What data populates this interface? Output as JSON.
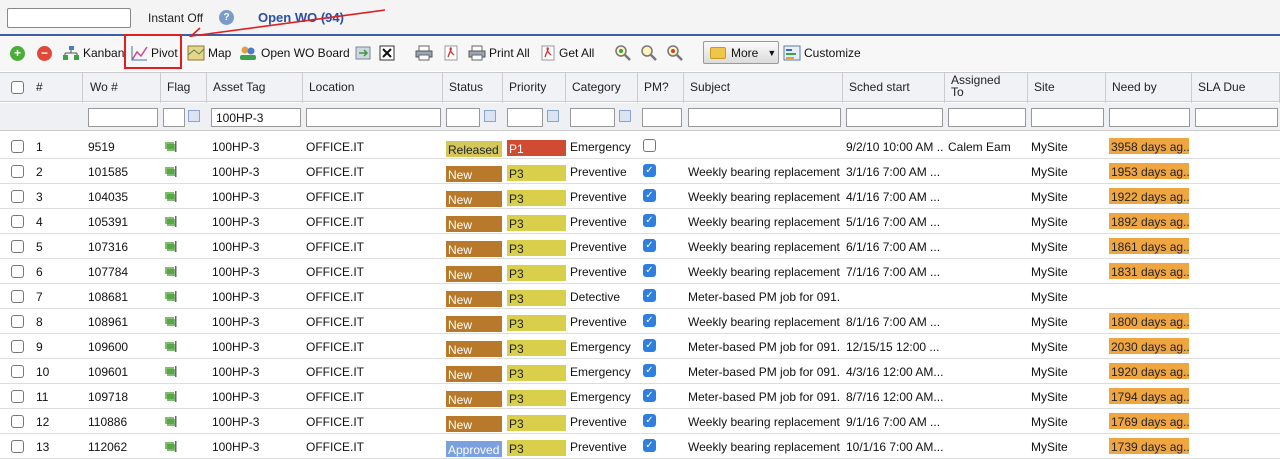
{
  "topbar": {
    "search_value": "",
    "instant_label": "Instant Off",
    "view_title": "Open WO (94)"
  },
  "toolbar": {
    "kanban": "Kanban",
    "pivot": "Pivot",
    "map": "Map",
    "open_wo_board": "Open WO Board",
    "print_all": "Print All",
    "get_all": "Get All",
    "more": "More",
    "customize": "Customize"
  },
  "columns": {
    "num": "#",
    "wo": "Wo #",
    "flag": "Flag",
    "asset_tag": "Asset Tag",
    "location": "Location",
    "status": "Status",
    "priority": "Priority",
    "category": "Category",
    "pm": "PM?",
    "subject": "Subject",
    "sched_start": "Sched start",
    "assigned_to_1": "Assigned",
    "assigned_to_2": "To",
    "site": "Site",
    "need_by": "Need by",
    "sla_due": "SLA Due"
  },
  "filters": {
    "asset_tag": "100HP-3"
  },
  "colors": {
    "status_released": "#d4c85a",
    "status_new": "#b87a2a",
    "status_approved": "#7aa0e0",
    "priority_p1": "#d14a32",
    "priority_p3": "#d9cf4a",
    "need_by": "#f0a640",
    "accent": "#2a4fa8"
  },
  "rows": [
    {
      "n": "1",
      "wo": "9519",
      "asset": "100HP-3",
      "loc": "OFFICE.IT",
      "status": "Released",
      "status_key": "released",
      "priority": "P1",
      "prio_key": "p1",
      "category": "Emergency",
      "pm": false,
      "subject": "",
      "sched": "9/2/10 10:00 AM ...",
      "assigned": "Calem Eam",
      "site": "MySite",
      "need": "3958 days ag..."
    },
    {
      "n": "2",
      "wo": "101585",
      "asset": "100HP-3",
      "loc": "OFFICE.IT",
      "status": "New",
      "status_key": "new",
      "priority": "P3",
      "prio_key": "p3",
      "category": "Preventive",
      "pm": true,
      "subject": "Weekly bearing replacement",
      "sched": "3/1/16 7:00 AM ...",
      "assigned": "",
      "site": "MySite",
      "need": "1953 days ag..."
    },
    {
      "n": "3",
      "wo": "104035",
      "asset": "100HP-3",
      "loc": "OFFICE.IT",
      "status": "New",
      "status_key": "new",
      "priority": "P3",
      "prio_key": "p3",
      "category": "Preventive",
      "pm": true,
      "subject": "Weekly bearing replacement",
      "sched": "4/1/16 7:00 AM ...",
      "assigned": "",
      "site": "MySite",
      "need": "1922 days ag..."
    },
    {
      "n": "4",
      "wo": "105391",
      "asset": "100HP-3",
      "loc": "OFFICE.IT",
      "status": "New",
      "status_key": "new",
      "priority": "P3",
      "prio_key": "p3",
      "category": "Preventive",
      "pm": true,
      "subject": "Weekly bearing replacement",
      "sched": "5/1/16 7:00 AM ...",
      "assigned": "",
      "site": "MySite",
      "need": "1892 days ag..."
    },
    {
      "n": "5",
      "wo": "107316",
      "asset": "100HP-3",
      "loc": "OFFICE.IT",
      "status": "New",
      "status_key": "new",
      "priority": "P3",
      "prio_key": "p3",
      "category": "Preventive",
      "pm": true,
      "subject": "Weekly bearing replacement",
      "sched": "6/1/16 7:00 AM ...",
      "assigned": "",
      "site": "MySite",
      "need": "1861 days ag..."
    },
    {
      "n": "6",
      "wo": "107784",
      "asset": "100HP-3",
      "loc": "OFFICE.IT",
      "status": "New",
      "status_key": "new",
      "priority": "P3",
      "prio_key": "p3",
      "category": "Preventive",
      "pm": true,
      "subject": "Weekly bearing replacement",
      "sched": "7/1/16 7:00 AM ...",
      "assigned": "",
      "site": "MySite",
      "need": "1831 days ag..."
    },
    {
      "n": "7",
      "wo": "108681",
      "asset": "100HP-3",
      "loc": "OFFICE.IT",
      "status": "New",
      "status_key": "new",
      "priority": "P3",
      "prio_key": "p3",
      "category": "Detective",
      "pm": true,
      "subject": "Meter-based PM job for 091...",
      "sched": "",
      "assigned": "",
      "site": "MySite",
      "need": ""
    },
    {
      "n": "8",
      "wo": "108961",
      "asset": "100HP-3",
      "loc": "OFFICE.IT",
      "status": "New",
      "status_key": "new",
      "priority": "P3",
      "prio_key": "p3",
      "category": "Preventive",
      "pm": true,
      "subject": "Weekly bearing replacement",
      "sched": "8/1/16 7:00 AM ...",
      "assigned": "",
      "site": "MySite",
      "need": "1800 days ag..."
    },
    {
      "n": "9",
      "wo": "109600",
      "asset": "100HP-3",
      "loc": "OFFICE.IT",
      "status": "New",
      "status_key": "new",
      "priority": "P3",
      "prio_key": "p3",
      "category": "Emergency",
      "pm": true,
      "subject": "Meter-based PM job for 091...",
      "sched": "12/15/15 12:00 ...",
      "assigned": "",
      "site": "MySite",
      "need": "2030 days ag..."
    },
    {
      "n": "10",
      "wo": "109601",
      "asset": "100HP-3",
      "loc": "OFFICE.IT",
      "status": "New",
      "status_key": "new",
      "priority": "P3",
      "prio_key": "p3",
      "category": "Emergency",
      "pm": true,
      "subject": "Meter-based PM job for 091...",
      "sched": "4/3/16 12:00 AM...",
      "assigned": "",
      "site": "MySite",
      "need": "1920 days ag..."
    },
    {
      "n": "11",
      "wo": "109718",
      "asset": "100HP-3",
      "loc": "OFFICE.IT",
      "status": "New",
      "status_key": "new",
      "priority": "P3",
      "prio_key": "p3",
      "category": "Emergency",
      "pm": true,
      "subject": "Meter-based PM job for 091...",
      "sched": "8/7/16 12:00 AM...",
      "assigned": "",
      "site": "MySite",
      "need": "1794 days ag..."
    },
    {
      "n": "12",
      "wo": "110886",
      "asset": "100HP-3",
      "loc": "OFFICE.IT",
      "status": "New",
      "status_key": "new",
      "priority": "P3",
      "prio_key": "p3",
      "category": "Preventive",
      "pm": true,
      "subject": "Weekly bearing replacement",
      "sched": "9/1/16 7:00 AM ...",
      "assigned": "",
      "site": "MySite",
      "need": "1769 days ag..."
    },
    {
      "n": "13",
      "wo": "112062",
      "asset": "100HP-3",
      "loc": "OFFICE.IT",
      "status": "Approved",
      "status_key": "approved",
      "priority": "P3",
      "prio_key": "p3",
      "category": "Preventive",
      "pm": true,
      "subject": "Weekly bearing replacement",
      "sched": "10/1/16 7:00 AM...",
      "assigned": "",
      "site": "MySite",
      "need": "1739 days ag..."
    }
  ]
}
